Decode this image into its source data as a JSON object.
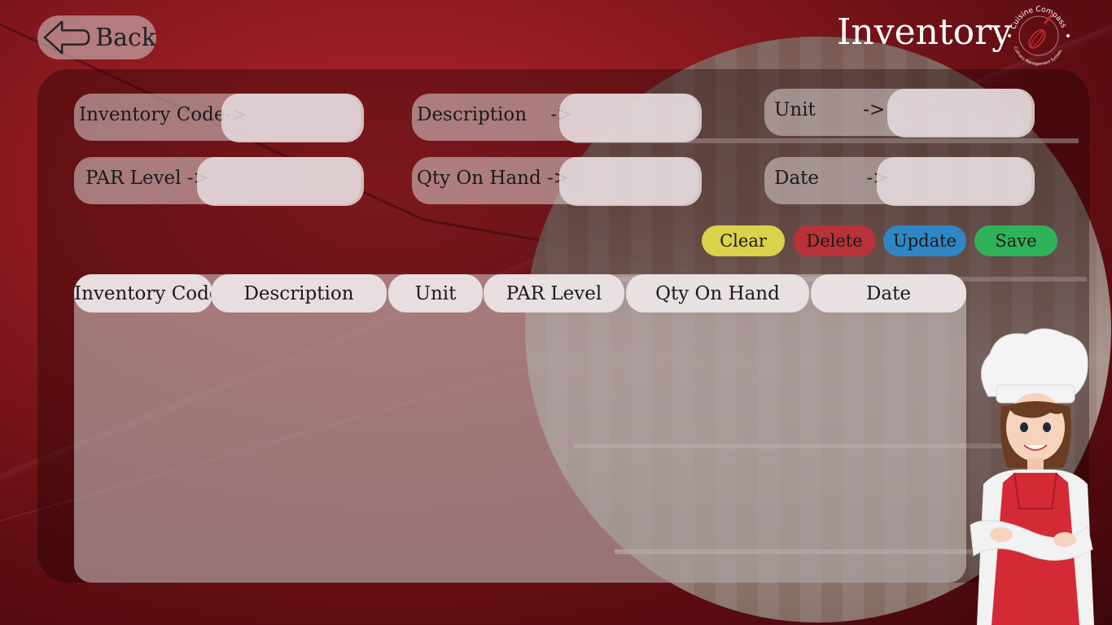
{
  "header": {
    "back_label": "Back",
    "title": "Inventory",
    "logo_text_top": "Cuisine Compass",
    "logo_text_bottom": "Culinary Management System"
  },
  "form": {
    "inventory_code": {
      "label": "Inventory Code->",
      "value": ""
    },
    "description": {
      "label": "Description    ->",
      "value": ""
    },
    "unit": {
      "label": "Unit        ->",
      "value": ""
    },
    "par_level": {
      "label": "PAR Level ->",
      "value": ""
    },
    "qty_on_hand": {
      "label": "Qty On Hand ->",
      "value": ""
    },
    "date": {
      "label": "Date        ->",
      "value": ""
    }
  },
  "actions": {
    "clear": "Clear",
    "delete": "Delete",
    "update": "Update",
    "save": "Save"
  },
  "table": {
    "columns": [
      "Inventory Code",
      "Description",
      "Unit",
      "PAR Level",
      "Qty On Hand",
      "Date"
    ],
    "rows": []
  },
  "colors": {
    "background": "#8c1a20",
    "clear": "#d9d24a",
    "delete": "#b8323a",
    "update": "#2f86c4",
    "save": "#2fb35a"
  }
}
